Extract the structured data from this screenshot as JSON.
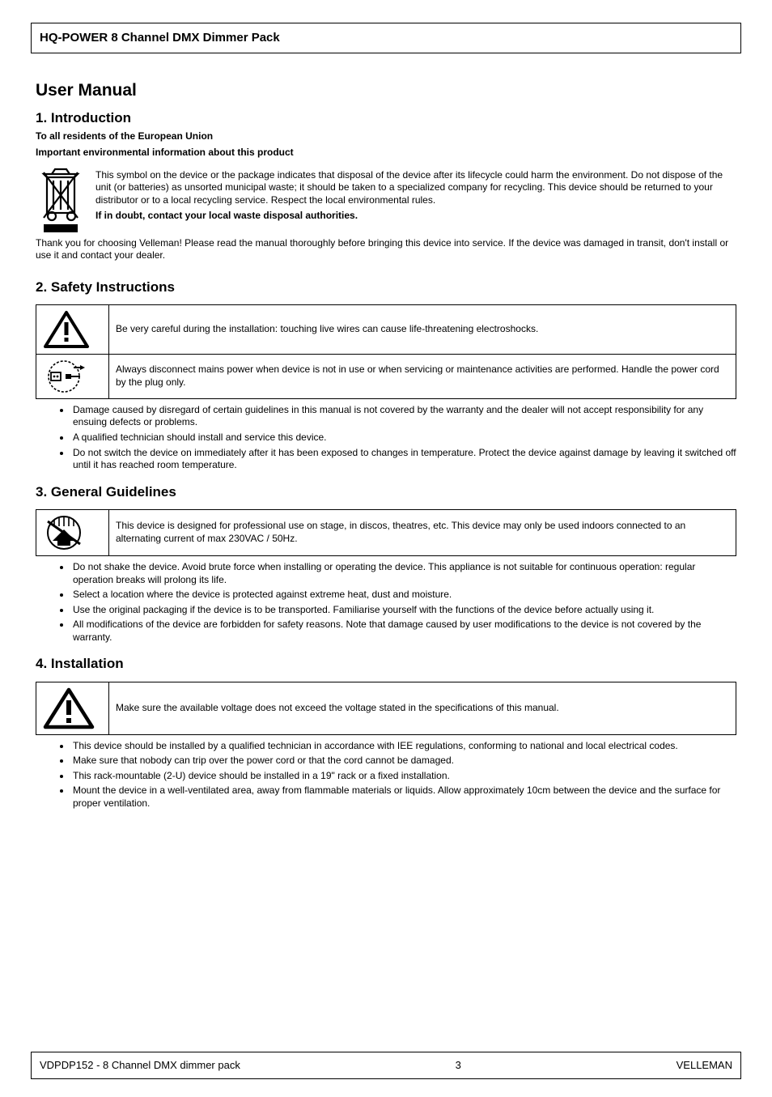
{
  "header": {
    "title": "HQ-POWER 8 Channel DMX Dimmer Pack"
  },
  "section_title": "User Manual",
  "intro": {
    "heading": "1. Introduction",
    "to_all": "To all residents of the European Union",
    "env_info": "Important environmental information about this product",
    "weee_text": "This symbol on the device or the package indicates that disposal of the device after its lifecycle could harm the environment. Do not dispose of the unit (or batteries) as unsorted municipal waste; it should be taken to a specialized company for recycling. This device should be returned to your distributor or to a local recycling service. Respect the local environmental rules.",
    "doubt": "If in doubt, contact your local waste disposal authorities.",
    "thanks": "Thank you for choosing Velleman! Please read the manual thoroughly before bringing this device into service. If the device was damaged in transit, don't install or use it and contact your dealer."
  },
  "safety": {
    "heading": "2. Safety Instructions",
    "warn_row": "Be very careful during the installation: touching live wires can cause life-threatening electroshocks.",
    "unplug_row": "Always disconnect mains power when device is not in use or when servicing or maintenance activities are performed. Handle the power cord by the plug only.",
    "bullets": [
      "Damage caused by disregard of certain guidelines in this manual is not covered by the warranty and the dealer will not accept responsibility for any ensuing defects or problems.",
      "A qualified technician should install and service this device.",
      "Do not switch the device on immediately after it has been exposed to changes in temperature. Protect the device against damage by leaving it switched off until it has reached room temperature."
    ]
  },
  "general": {
    "heading": "3. General Guidelines",
    "indoor_row": "This device is designed for professional use on stage, in discos, theatres, etc. This device may only be used indoors connected to an alternating current of max 230VAC / 50Hz.",
    "bullets": [
      "Do not shake the device. Avoid brute force when installing or operating the device. This appliance is not suitable for continuous operation: regular operation breaks will prolong its life.",
      "Select a location where the device is protected against extreme heat, dust and moisture.",
      "Use the original packaging if the device is to be transported. Familiarise yourself with the functions of the device before actually using it.",
      "All modifications of the device are forbidden for safety reasons. Note that damage caused by user modifications to the device is not covered by the warranty."
    ]
  },
  "install": {
    "heading": "4. Installation",
    "warn_row": "Make sure the available voltage does not exceed the voltage stated in the specifications of this manual.",
    "bullets": [
      "This device should be installed by a qualified technician in accordance with IEE regulations, conforming to national and local electrical codes.",
      "Make sure that nobody can trip over the power cord or that the cord cannot be damaged.",
      "This rack-mountable (2-U) device should be installed in a 19\" rack or a fixed installation.",
      "Mount the device in a well-ventilated area, away from flammable materials or liquids. Allow approximately 10cm between the device and the surface for proper ventilation."
    ]
  },
  "footer": {
    "left": "VDPDP152 - 8 Channel DMX dimmer pack",
    "right_label": "VELLEMAN",
    "page_number": "3"
  },
  "icons": {
    "weee": "weee-bin-icon",
    "warning": "warning-triangle-icon",
    "unplug": "unplug-icon",
    "indoor": "indoor-use-icon"
  }
}
